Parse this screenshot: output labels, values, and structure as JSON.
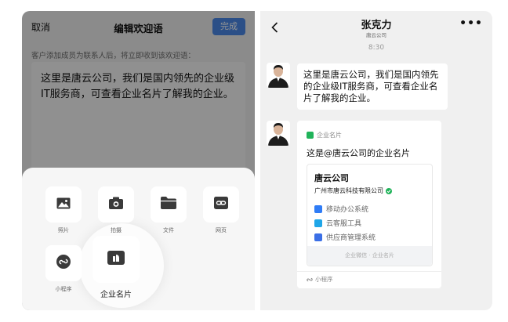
{
  "editor_screen": {
    "cancel_label": "取消",
    "title": "编辑欢迎语",
    "done_label": "完成",
    "hint": "客户添加成员为联系人后，将立即收到该欢迎语：",
    "message": "这里是唐云公司，我们是国内领先的企业级IT服务商，可查看企业名片了解我的企业。"
  },
  "attachment_sheet": {
    "items": [
      {
        "label": "照片",
        "icon": "image-icon"
      },
      {
        "label": "拍摄",
        "icon": "camera-icon"
      },
      {
        "label": "文件",
        "icon": "folder-icon"
      },
      {
        "label": "网页",
        "icon": "link-icon"
      },
      {
        "label": "小程序",
        "icon": "mini-program-icon"
      },
      {
        "label": "企业名片",
        "icon": "business-card-icon"
      }
    ]
  },
  "chat_screen": {
    "contact_name": "张克力",
    "contact_org": "唐云公司",
    "time": "8:30",
    "welcome_message": "这里是唐云公司，我们是国内领先的企业级IT服务商，可查看企业名片了解我的企业。",
    "card": {
      "tag": "企业名片",
      "text": "这是@唐云公司的企业名片",
      "company_short": "唐云公司",
      "company_full": "广州市唐云科技有限公司",
      "services": [
        {
          "label": "移动办公系统",
          "color": "#2f7cf6"
        },
        {
          "label": "云客服工具",
          "color": "#1fa6e8"
        },
        {
          "label": "供应商管理系统",
          "color": "#3b6fe6"
        }
      ],
      "footer": "企业微信 · 企业名片",
      "source": "小程序"
    }
  },
  "colors": {
    "accent_blue": "#4b89e8",
    "verify_green": "#21b35a"
  }
}
